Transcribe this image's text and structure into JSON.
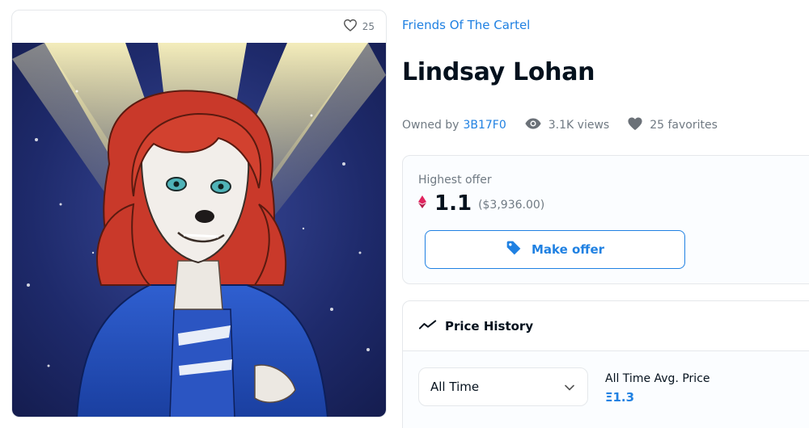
{
  "item_card": {
    "favorites_count": "25",
    "image_alt": "Lindsay Lohan"
  },
  "collection": {
    "name": "Friends Of The Cartel"
  },
  "item": {
    "title": "Lindsay Lohan"
  },
  "meta": {
    "owned_by_label": "Owned by",
    "owner": "3B17F0",
    "views": "3.1K views",
    "favorites": "25 favorites"
  },
  "offer": {
    "label": "Highest offer",
    "price": "1.1",
    "usd": "($3,936.00)",
    "button_label": "Make offer"
  },
  "price_history": {
    "title": "Price History",
    "range_selected": "All Time",
    "avg_label": "All Time Avg. Price",
    "avg_value": "Ξ1.3"
  },
  "colors": {
    "accent": "#2081e2",
    "eth_pink": "#e0245e",
    "text_dark": "#04111d",
    "text_muted": "#707a83"
  },
  "icons": [
    "heart-outline-icon",
    "eye-icon",
    "heart-filled-icon",
    "eth-icon",
    "tag-icon",
    "trend-line-icon",
    "chevron-down-icon"
  ]
}
